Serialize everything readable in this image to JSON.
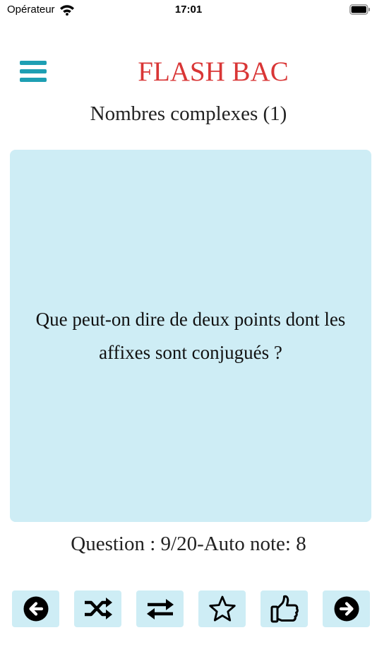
{
  "status_bar": {
    "carrier": "Opérateur",
    "time": "17:01",
    "icons": [
      "wifi-icon",
      "battery-icon"
    ]
  },
  "header": {
    "menu_icon": "hamburger-menu-icon",
    "title": "FLASH BAC",
    "subtitle": "Nombres complexes (1)"
  },
  "card": {
    "question": "Que peut-on dire de deux points dont les affixes sont conjugués ?"
  },
  "progress": {
    "text": "Question : 9/20-Auto note: 8"
  },
  "toolbar": {
    "buttons": [
      {
        "icon": "arrow-left-circle-icon"
      },
      {
        "icon": "shuffle-icon"
      },
      {
        "icon": "repeat-arrows-icon"
      },
      {
        "icon": "star-icon"
      },
      {
        "icon": "thumbs-up-icon"
      },
      {
        "icon": "arrow-right-circle-icon"
      }
    ]
  },
  "colors": {
    "title_red": "#d93636",
    "menu_teal": "#1e9fb3",
    "card_bg": "#ceedf5",
    "button_bg": "#ceedf5"
  }
}
